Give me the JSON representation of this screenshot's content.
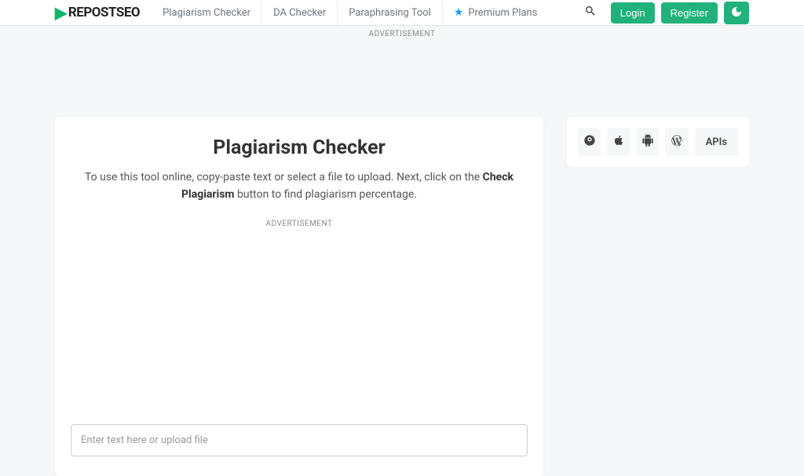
{
  "header": {
    "logo_text": "REPOSTSEO",
    "nav": [
      {
        "label": "Plagiarism Checker"
      },
      {
        "label": "DA Checker"
      },
      {
        "label": "Paraphrasing Tool"
      },
      {
        "label": "Premium Plans"
      }
    ],
    "login": "Login",
    "register": "Register"
  },
  "ad_label": "ADVERTISEMENT",
  "main": {
    "title": "Plagiarism Checker",
    "desc_pre": "To use this tool online, copy-paste text or select a file to upload. Next, click on the ",
    "desc_bold": "Check Plagiarism",
    "desc_post": " button to find plagiarism percentage.",
    "input_placeholder": "Enter text here or upload file"
  },
  "sidebar": {
    "apis_label": "APIs"
  }
}
